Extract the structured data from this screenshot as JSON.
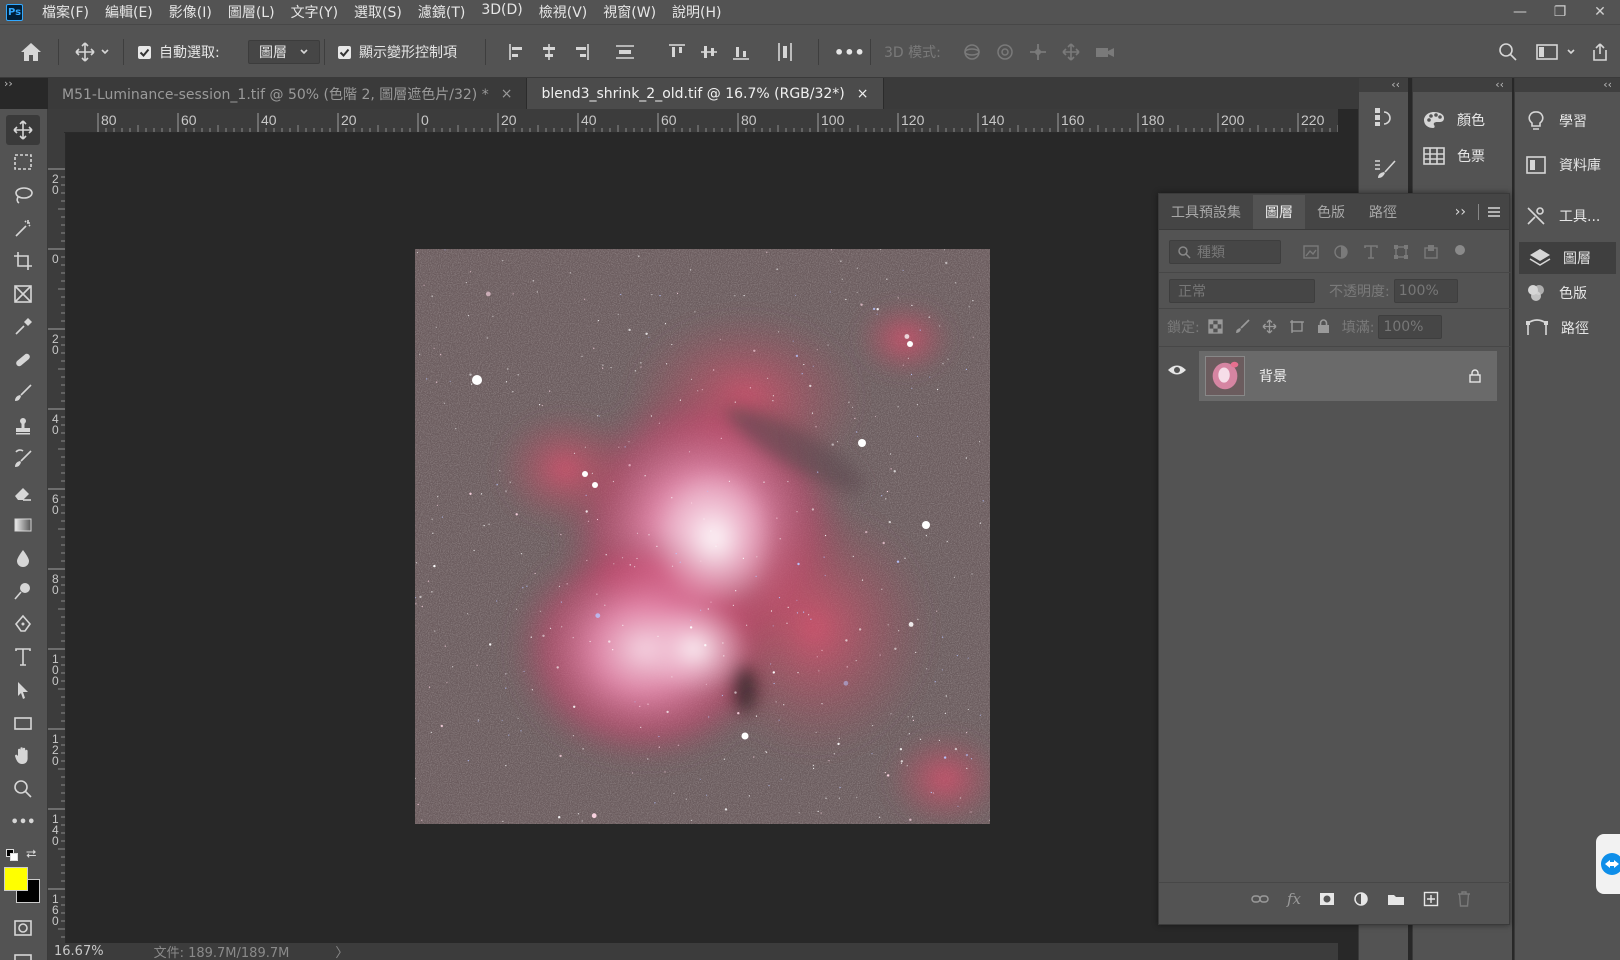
{
  "menubar": {
    "logo": "Ps",
    "items": [
      "檔案(F)",
      "編輯(E)",
      "影像(I)",
      "圖層(L)",
      "文字(Y)",
      "選取(S)",
      "濾鏡(T)",
      "3D(D)",
      "檢視(V)",
      "視窗(W)",
      "說明(H)"
    ],
    "minimize": "—",
    "restore": "❐",
    "close": "✕"
  },
  "options": {
    "auto_select_label": "自動選取:",
    "auto_select_checked": true,
    "auto_select_target": "圖層",
    "show_transform_label": "顯示變形控制項",
    "show_transform_checked": true,
    "more": "•••",
    "mode_3d_label": "3D 模式:"
  },
  "tabs": [
    {
      "label": "M51-Luminance-session_1.tif @ 50% (色階 2, 圖層遮色片/32) *",
      "close": "×",
      "active": false
    },
    {
      "label": "blend3_shrink_2_old.tif @ 16.7% (RGB/32*)",
      "close": "×",
      "active": true
    }
  ],
  "ruler": {
    "h_labels": [
      "80",
      "60",
      "40",
      "20",
      "0",
      "20",
      "40",
      "60",
      "80",
      "100",
      "120",
      "140",
      "160",
      "180",
      "200",
      "220"
    ],
    "v_labels": [
      "2\n0",
      "0",
      "2\n0",
      "4\n0",
      "6\n0",
      "8\n0",
      "1\n0\n0",
      "1\n2\n0",
      "1\n4\n0",
      "1\n6\n0"
    ]
  },
  "colors": {
    "foreground": "#ffff00",
    "background": "#000000",
    "accent": "#31a8ff"
  },
  "status": {
    "zoom": "16.67%",
    "doc_info": "文件: 189.7M/189.7M",
    "arrow": "〉"
  },
  "dock": {
    "col2": [
      {
        "icon": "palette-icon",
        "label": "顏色"
      },
      {
        "icon": "swatches-icon",
        "label": "色票"
      }
    ],
    "col3": [
      {
        "icon": "lightbulb-icon",
        "label": "學習"
      },
      {
        "icon": "library-icon",
        "label": "資料庫"
      },
      {
        "icon": "tool-presets-icon",
        "label": "工具..."
      },
      {
        "icon": "layers-icon",
        "label": "圖層"
      },
      {
        "icon": "channels-icon",
        "label": "色版"
      },
      {
        "icon": "paths-icon",
        "label": "路徑"
      }
    ],
    "collapse": "‹‹"
  },
  "layers_panel": {
    "tabs": [
      "工具預設集",
      "圖層",
      "色版",
      "路徑"
    ],
    "active_tab": "圖層",
    "expand": "››",
    "filter_placeholder": "種類",
    "blend_mode": "正常",
    "opacity_label": "不透明度:",
    "opacity_value": "100%",
    "lock_label": "鎖定:",
    "fill_label": "填滿:",
    "fill_value": "100%",
    "layers": [
      {
        "name": "背景",
        "visible": true,
        "locked": true
      }
    ]
  }
}
